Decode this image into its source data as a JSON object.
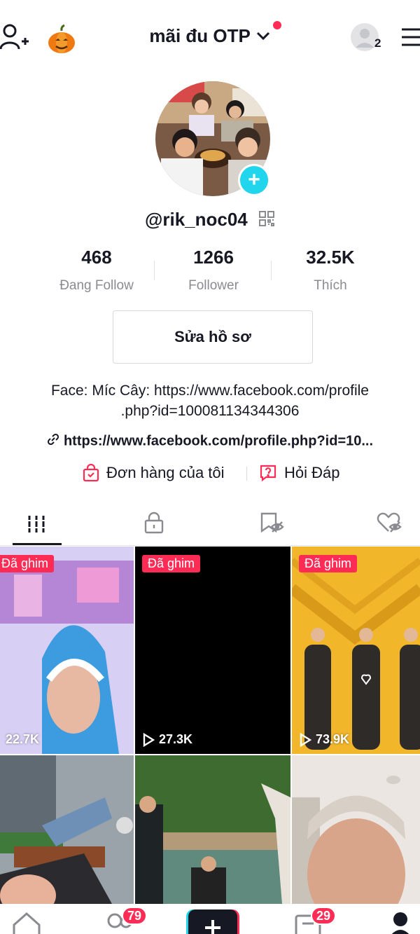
{
  "header": {
    "title": "mãi đu OTP",
    "friends_count": "2"
  },
  "profile": {
    "username": "@rik_noc04",
    "stats": [
      {
        "value": "468",
        "label": "Đang Follow"
      },
      {
        "value": "1266",
        "label": "Follower"
      },
      {
        "value": "32.5K",
        "label": "Thích"
      }
    ],
    "edit_label": "Sửa hồ sơ",
    "bio_line1": "Face: Míc Cây: https://www.facebook.com/profile",
    "bio_line2": ".php?id=100081134344306",
    "link": "https://www.facebook.com/profile.php?id=10...",
    "orders_label": "Đơn hàng của tôi",
    "qa_label": "Hỏi Đáp"
  },
  "videos": [
    {
      "pinned": "Đã ghim",
      "views": "22.7K"
    },
    {
      "pinned": "Đã ghim",
      "views": "27.3K"
    },
    {
      "pinned": "Đã ghim",
      "views": "73.9K"
    },
    {
      "pinned": "",
      "views": ""
    },
    {
      "pinned": "",
      "views": ""
    },
    {
      "pinned": "",
      "views": ""
    }
  ],
  "nav": {
    "friends_badge": "79",
    "inbox_badge": "29"
  },
  "colors": {
    "accent": "#fe2c55",
    "plus_badge": "#20d5ec",
    "text": "#161823",
    "muted": "#8a8b91"
  }
}
